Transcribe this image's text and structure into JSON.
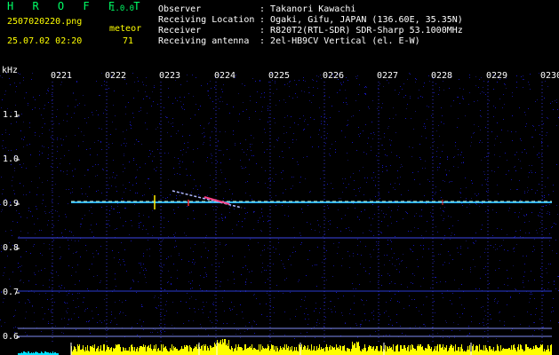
{
  "header": {
    "brand": "H R O F F T",
    "version": "1.0.0",
    "filename": "2507020220.png",
    "datetime": "25.07.02 02:20",
    "meteor_label": "meteor",
    "meteor_count": "71"
  },
  "info": [
    {
      "key": "Observer",
      "value": "Takanori Kawachi"
    },
    {
      "key": "Receiving Location",
      "value": "Ogaki, Gifu, JAPAN (136.60E, 35.35N)"
    },
    {
      "key": "Receiver",
      "value": "R820T2(RTL-SDR) SDR-Sharp 53.1000MHz"
    },
    {
      "key": "Receiving antenna",
      "value": "2el-HB9CV Vertical (el. E-W)"
    }
  ],
  "axis": {
    "y_unit": "kHz",
    "x_ticks": [
      "0221",
      "0222",
      "0223",
      "0224",
      "0225",
      "0226",
      "0227",
      "0228",
      "0229",
      "0230"
    ],
    "y_ticks": [
      "1.1",
      "1.0",
      "0.9",
      "0.8",
      "0.7",
      "0.6"
    ]
  },
  "colors": {
    "background": "#000000",
    "noise": "#14148c",
    "header_yellow": "#ffff00",
    "baseline_level": "#ffff00",
    "baseline_low": "#00e0ff"
  }
}
